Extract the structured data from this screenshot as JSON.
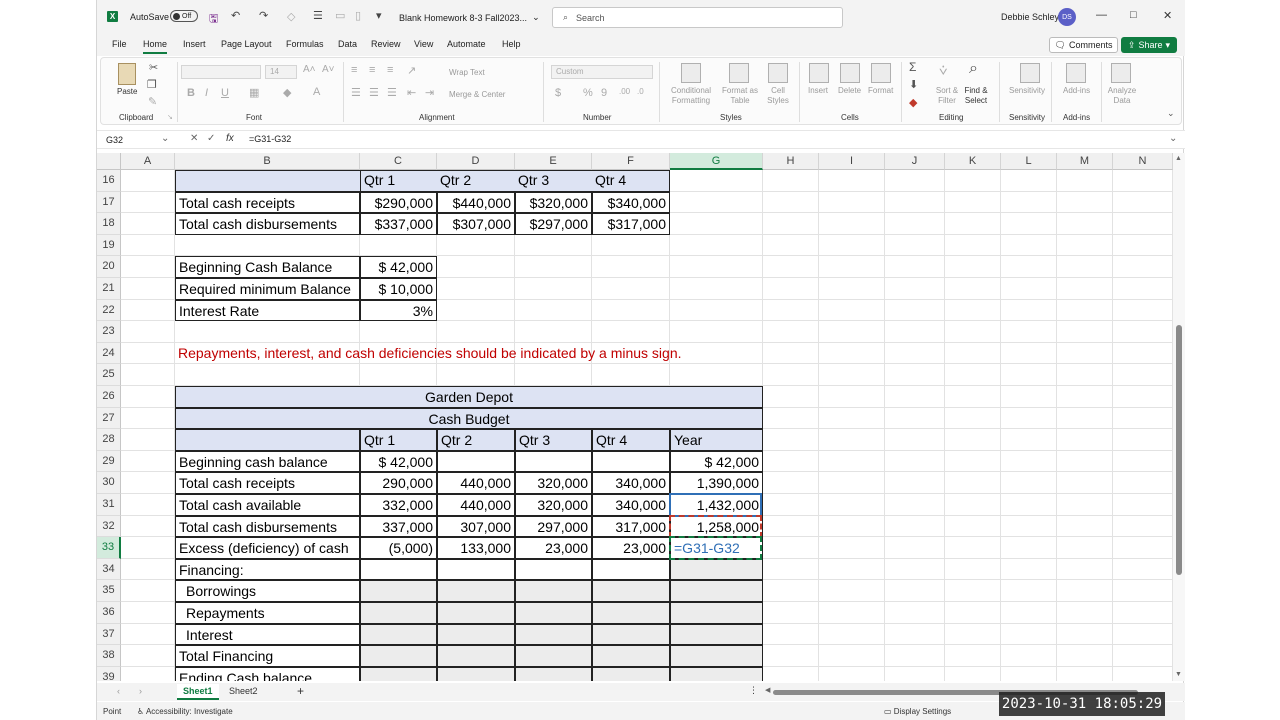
{
  "titlebar": {
    "autosave_label": "AutoSave",
    "autosave_state": "Off",
    "doc_title": "Blank Homework 8-3 Fall2023...",
    "search_placeholder": "Search",
    "user_name": "Debbie Schley",
    "user_initials": "DS"
  },
  "menu": {
    "tabs": [
      "File",
      "Home",
      "Insert",
      "Page Layout",
      "Formulas",
      "Data",
      "Review",
      "View",
      "Automate",
      "Help"
    ],
    "active": "Home",
    "comments": "Comments",
    "share": "Share"
  },
  "ribbon": {
    "clipboard": {
      "paste": "Paste",
      "label": "Clipboard"
    },
    "font": {
      "name_value": "",
      "size_value": "14",
      "label": "Font"
    },
    "alignment": {
      "wrap": "Wrap Text",
      "merge": "Merge & Center",
      "label": "Alignment"
    },
    "number": {
      "format": "Custom",
      "label": "Number"
    },
    "styles": {
      "conditional": "Conditional Formatting",
      "format_table": "Format as Table",
      "cell_styles": "Cell Styles",
      "label": "Styles"
    },
    "cells": {
      "insert": "Insert",
      "delete": "Delete",
      "format": "Format",
      "label": "Cells"
    },
    "editing": {
      "sort": "Sort & Filter",
      "find": "Find & Select",
      "label": "Editing"
    },
    "sensitivity": {
      "btn": "Sensitivity",
      "label": "Sensitivity"
    },
    "addins": {
      "btn": "Add-ins",
      "label": "Add-ins"
    },
    "analyze": {
      "btn": "Analyze Data"
    }
  },
  "formula_bar": {
    "name_box": "G32",
    "formula": "=G31-G32"
  },
  "columns": [
    "A",
    "B",
    "C",
    "D",
    "E",
    "F",
    "G",
    "H",
    "I",
    "J",
    "K",
    "L",
    "M",
    "N"
  ],
  "rows": [
    "16",
    "17",
    "18",
    "19",
    "20",
    "21",
    "22",
    "23",
    "24",
    "25",
    "26",
    "27",
    "28",
    "29",
    "30",
    "31",
    "32",
    "33",
    "34",
    "35",
    "36",
    "37",
    "38",
    "39"
  ],
  "sheet": {
    "top_table": {
      "headers": [
        "Qtr 1",
        "Qtr 2",
        "Qtr 3",
        "Qtr 4"
      ],
      "rows": [
        {
          "label": "Total cash receipts",
          "values": [
            "$290,000",
            "$440,000",
            "$320,000",
            "$340,000"
          ]
        },
        {
          "label": "Total cash disbursements",
          "values": [
            "$337,000",
            "$307,000",
            "$297,000",
            "$317,000"
          ]
        }
      ]
    },
    "params": [
      {
        "label": "Beginning Cash Balance",
        "value": "$  42,000"
      },
      {
        "label": "Required minimum Balance",
        "value": "$  10,000"
      },
      {
        "label": "Interest Rate",
        "value": "3%"
      }
    ],
    "note": "Repayments, interest, and cash deficiencies should be indicated by a minus sign.",
    "budget": {
      "company": "Garden Depot",
      "title": "Cash Budget",
      "headers": [
        "Qtr 1",
        "Qtr 2",
        "Qtr 3",
        "Qtr 4",
        "Year"
      ],
      "rows": [
        {
          "label": "Beginning cash balance",
          "values": [
            "$  42,000",
            "",
            "",
            "",
            "$      42,000"
          ]
        },
        {
          "label": "Total cash receipts",
          "values": [
            "290,000",
            "440,000",
            "320,000",
            "340,000",
            "1,390,000"
          ]
        },
        {
          "label": "Total cash available",
          "values": [
            "332,000",
            "440,000",
            "320,000",
            "340,000",
            "1,432,000"
          ]
        },
        {
          "label": "Total cash disbursements",
          "values": [
            "337,000",
            "307,000",
            "297,000",
            "317,000",
            "1,258,000"
          ]
        },
        {
          "label": "Excess (deficiency) of cash",
          "values": [
            "(5,000)",
            "133,000",
            "23,000",
            "23,000",
            "=G31-G32"
          ]
        },
        {
          "label": "Financing:",
          "values": [
            "",
            "",
            "",
            "",
            ""
          ]
        },
        {
          "label": "Borrowings",
          "values": [
            "",
            "",
            "",
            "",
            ""
          ]
        },
        {
          "label": "Repayments",
          "values": [
            "",
            "",
            "",
            "",
            ""
          ]
        },
        {
          "label": "Interest",
          "values": [
            "",
            "",
            "",
            "",
            ""
          ]
        },
        {
          "label": "Total Financing",
          "values": [
            "",
            "",
            "",
            "",
            ""
          ]
        },
        {
          "label": "Ending Cash balance",
          "values": [
            "",
            "",
            "",
            "",
            ""
          ]
        }
      ]
    }
  },
  "sheets": [
    "Sheet1",
    "Sheet2"
  ],
  "status": {
    "mode": "Point",
    "accessibility": "Accessibility: Investigate",
    "display": "Display Settings"
  },
  "timestamp": "2023-10-31  18:05:29",
  "colors": {
    "excel_green": "#107c41",
    "header_blue": "#dde3f3",
    "note_red": "#c00000"
  }
}
